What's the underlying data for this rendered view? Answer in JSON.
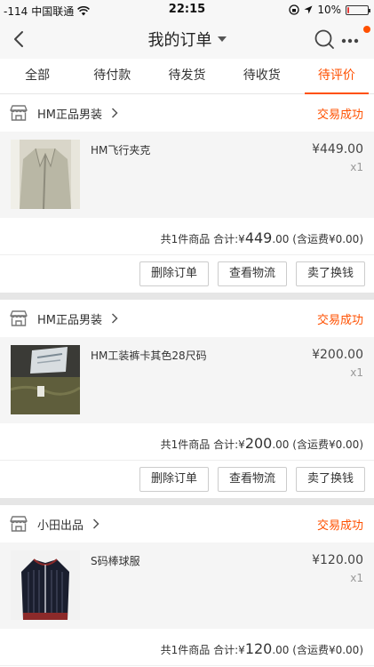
{
  "status_bar": {
    "signal": "-114",
    "carrier": "中国联通",
    "time": "22:15",
    "battery": "10%",
    "battery_level": 0.1
  },
  "nav": {
    "title": "我的订单"
  },
  "tabs": [
    {
      "label": "全部"
    },
    {
      "label": "待付款"
    },
    {
      "label": "待发货"
    },
    {
      "label": "待收货"
    },
    {
      "label": "待评价",
      "active": true
    }
  ],
  "orders": [
    {
      "shop": "HM正品男装",
      "status": "交易成功",
      "item_title": "HM飞行夹克",
      "price": "¥449.00",
      "qty": "x1",
      "summary_prefix": "共1件商品 合计:",
      "total_symbol": "¥",
      "total_int": "449",
      "total_dec": ".00",
      "shipping": "(含运费¥0.00)",
      "buttons": [
        "删除订单",
        "查看物流",
        "卖了换钱"
      ]
    },
    {
      "shop": "HM正品男装",
      "status": "交易成功",
      "item_title": "HM工装裤卡其色28尺码",
      "price": "¥200.00",
      "qty": "x1",
      "summary_prefix": "共1件商品 合计:",
      "total_symbol": "¥",
      "total_int": "200",
      "total_dec": ".00",
      "shipping": "(含运费¥0.00)",
      "buttons": [
        "删除订单",
        "查看物流",
        "卖了换钱"
      ]
    },
    {
      "shop": "小田出品",
      "status": "交易成功",
      "item_title": "S码棒球服",
      "price": "¥120.00",
      "qty": "x1",
      "summary_prefix": "共1件商品 合计:",
      "total_symbol": "¥",
      "total_int": "120",
      "total_dec": ".00",
      "shipping": "(含运费¥0.00)"
    }
  ],
  "colors": {
    "accent": "#ff5000",
    "divider": "#e6e6e6",
    "item_bg": "#f5f5f5"
  }
}
